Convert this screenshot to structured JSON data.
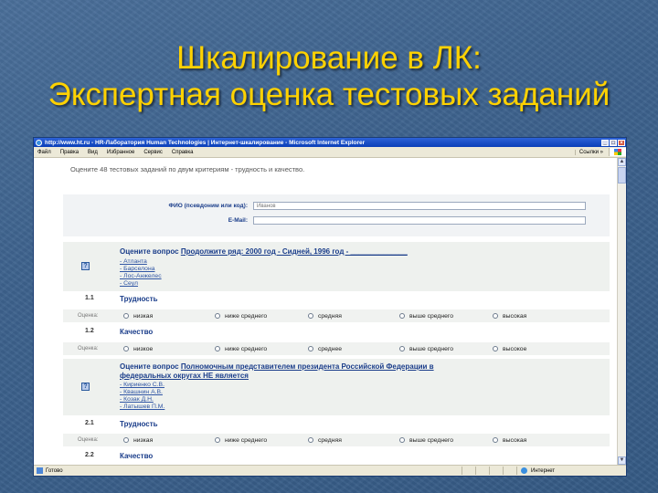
{
  "slide": {
    "title_line1": "Шкалирование в ЛК:",
    "title_line2": "Экспертная оценка тестовых заданий"
  },
  "browser": {
    "window_title": "http://www.ht.ru - HR-Лаборатория Human Technologies | Интернет-шкалирование - Microsoft Internet Explorer",
    "menu": [
      "Файл",
      "Правка",
      "Вид",
      "Избранное",
      "Сервис",
      "Справка"
    ],
    "links_label": "Ссылки",
    "status_text": "Готово",
    "zone_text": "Интернет"
  },
  "page": {
    "intro": "Оцените 48 тестовых заданий по двум критериям - трудность и качество.",
    "fio_label": "ФИО (псевдоним или код):",
    "fio_value": "Иванов",
    "email_label": "E-Mail:",
    "email_value": "",
    "scale_label": "Оценка:",
    "difficulty_scale": [
      "низкая",
      "ниже среднего",
      "средняя",
      "выше среднего",
      "высокая"
    ],
    "quality_scale": [
      "низкое",
      "ниже среднего",
      "среднее",
      "выше среднего",
      "высокое"
    ],
    "questions": [
      {
        "prefix": "Оцените вопрос",
        "text": "Продолжите ряд: 2000 год - Сидней, 1996 год - ______________",
        "options": [
          "- Атланта",
          "- Барселона",
          "- Лос-Анжелес",
          "- Сеул"
        ],
        "crit1_num": "1.1",
        "crit1_name": "Трудность",
        "crit2_num": "1.2",
        "crit2_name": "Качество"
      },
      {
        "prefix": "Оцените вопрос",
        "text_line1": "Полномочным представителем президента Российской Федерации в",
        "text_line2": "федеральных округах НЕ является",
        "options": [
          "- Кириенко С.В.",
          "- Квашнин А.В.",
          "- Козак Д.Н.",
          "- Латышев П.М."
        ],
        "crit1_num": "2.1",
        "crit1_name": "Трудность",
        "crit2_num": "2.2",
        "crit2_name": "Качество"
      }
    ]
  },
  "colors": {
    "title": "#ffd200",
    "link": "#1a3d8a",
    "background": "#3d628d"
  }
}
